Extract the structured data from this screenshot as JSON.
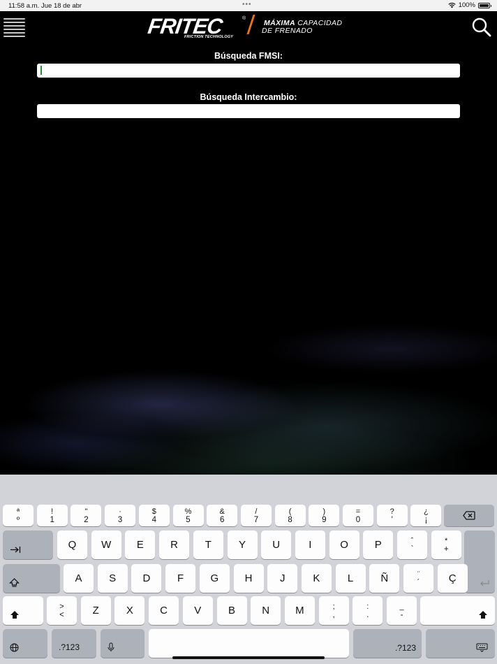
{
  "status_bar": {
    "time": "11:58 a.m.",
    "date": "Jue 18 de abr",
    "battery": "100%"
  },
  "header": {
    "logo_text": "FRITEC",
    "logo_registered": "®",
    "logo_subtitle": "FRICTION TECHNOLOGY",
    "tagline_bold": "MÁXIMA",
    "tagline_rest": " CAPACIDAD",
    "tagline_line2": "DE FRENADO",
    "accent_color": "#e8741c"
  },
  "search": {
    "fmsi_label": "Búsqueda FMSI:",
    "fmsi_value": "",
    "exchange_label": "Búsqueda Intercambio:",
    "exchange_value": ""
  },
  "keyboard": {
    "row1": [
      {
        "top": "ª",
        "bottom": "º"
      },
      {
        "top": "!",
        "bottom": "1"
      },
      {
        "top": "\"",
        "bottom": "2"
      },
      {
        "top": "·",
        "bottom": "3"
      },
      {
        "top": "$",
        "bottom": "4"
      },
      {
        "top": "%",
        "bottom": "5"
      },
      {
        "top": "&",
        "bottom": "6"
      },
      {
        "top": "/",
        "bottom": "7"
      },
      {
        "top": "(",
        "bottom": "8"
      },
      {
        "top": ")",
        "bottom": "9"
      },
      {
        "top": "=",
        "bottom": "0"
      },
      {
        "top": "?",
        "bottom": "'"
      },
      {
        "top": "¿",
        "bottom": "¡"
      }
    ],
    "row2": [
      "Q",
      "W",
      "E",
      "R",
      "T",
      "Y",
      "U",
      "I",
      "O",
      "P"
    ],
    "row2_extra": [
      {
        "top": "ˆ",
        "bottom": "`"
      },
      {
        "top": "*",
        "bottom": "+"
      }
    ],
    "row3": [
      "A",
      "S",
      "D",
      "F",
      "G",
      "H",
      "J",
      "K",
      "L",
      "Ñ"
    ],
    "row3_extra": [
      {
        "top": "¨",
        "bottom": "´"
      },
      {
        "top": "",
        "bottom": "Ç"
      }
    ],
    "row4": [
      {
        "top": ">",
        "bottom": "<"
      },
      "Z",
      "X",
      "C",
      "V",
      "B",
      "N",
      "M",
      {
        "top": ";",
        "bottom": ","
      },
      {
        "top": ":",
        "bottom": "."
      },
      {
        "top": "_",
        "bottom": "-"
      }
    ],
    "numbers_label": ".?123"
  }
}
